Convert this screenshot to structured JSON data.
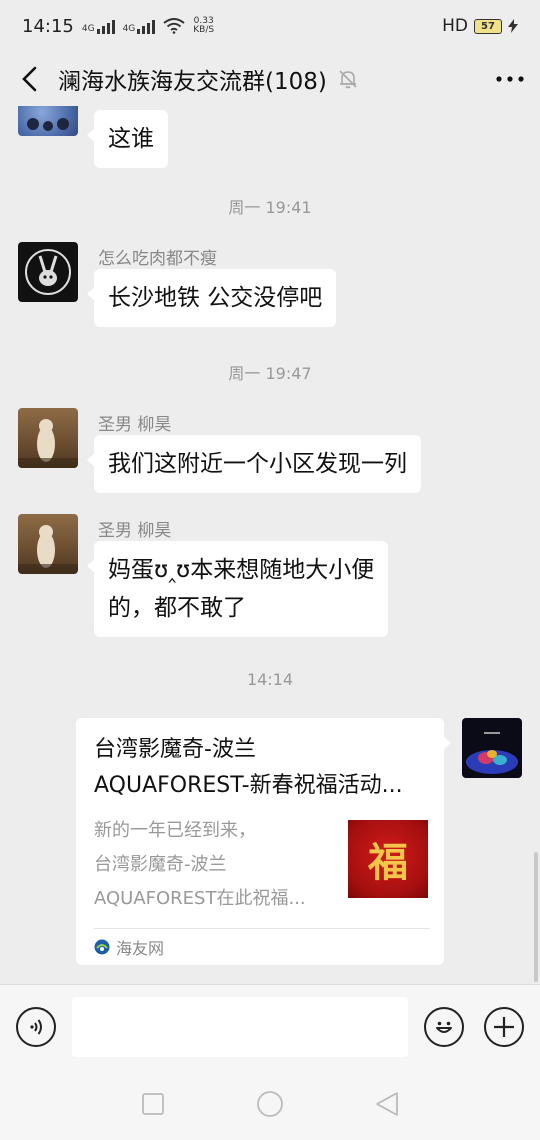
{
  "status_bar": {
    "time": "14:15",
    "net1": "4G",
    "net2": "4G",
    "speed_value": "0.33",
    "speed_unit": "KB/S",
    "hd_label": "HD",
    "battery": "57"
  },
  "header": {
    "title": "澜海水族海友交流群(108)"
  },
  "messages": [
    {
      "text": "这谁"
    },
    {
      "timestamp": "周一 19:41"
    },
    {
      "sender": "怎么吃肉都不瘦",
      "text": "长沙地铁 公交没停吧"
    },
    {
      "timestamp": "周一 19:47"
    },
    {
      "sender": "圣男  柳昊",
      "text": "我们这附近一个小区发现一列"
    },
    {
      "sender": "圣男  柳昊",
      "line1": "妈蛋ʊ‸ʊ本来想随地大小便",
      "line2": "的，都不敢了"
    },
    {
      "timestamp": "14:14"
    }
  ],
  "card": {
    "title_line1": "台湾影魔奇-波兰",
    "title_line2": "AQUAFOREST-新春祝福活动...",
    "desc_line1": "新的一年已经到来，",
    "desc_line2": "台湾影魔奇-波兰",
    "desc_line3": "AQUAFOREST在此祝福...",
    "thumb_char": "福",
    "source": "海友网"
  },
  "icons": {
    "back": "back-arrow-icon",
    "mute": "mute-bell-icon",
    "more": "more-dots-icon",
    "voice": "voice-icon",
    "emoji": "emoji-icon",
    "plus": "plus-icon"
  },
  "colors": {
    "background": "#ededed",
    "bubble": "#ffffff",
    "card_thumb": "#c8161d"
  }
}
